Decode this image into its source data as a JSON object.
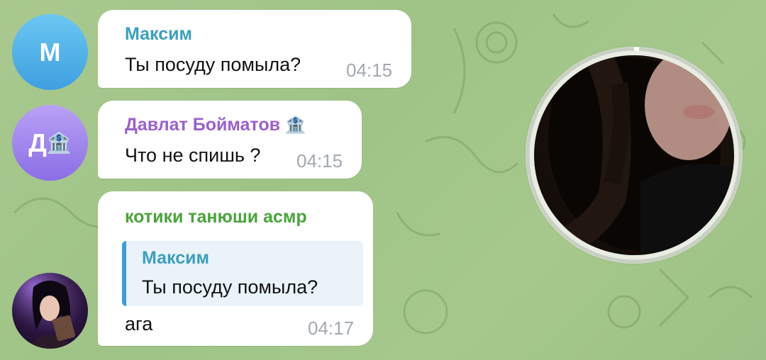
{
  "messages": [
    {
      "avatar_letter": "М",
      "avatar_color": "#4aa9e8",
      "sender": "Максим",
      "sender_color": "#3a9fbf",
      "text": "Ты посуду помыла?",
      "time": "04:15"
    },
    {
      "avatar_letter": "Д",
      "avatar_emoji": "🏦",
      "avatar_color": "#9479ea",
      "sender": "Давлат Бойматов",
      "sender_emoji": "🏦",
      "sender_color": "#9b5fd0",
      "text": "Что не спишь ?",
      "time": "04:15"
    },
    {
      "avatar_icon": "user-photo",
      "sender": "котики танюши асмр",
      "sender_color": "#4aa43a",
      "reply": {
        "sender": "Максим",
        "text": "Ты посуду помыла?",
        "accent": "#3a9fd4"
      },
      "text": "ага",
      "time": "04:17"
    }
  ],
  "video_message": {
    "icon": "round-video-message"
  },
  "theme": {
    "background": "#a3c68a",
    "bubble": "#ffffff",
    "time_color": "#a3a9b0"
  }
}
